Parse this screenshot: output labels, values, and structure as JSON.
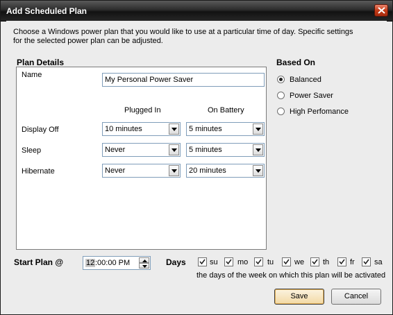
{
  "window": {
    "title": "Add Scheduled Plan"
  },
  "intro_line1": "Choose a Windows power plan that you would like to use at a particular time of day.  Specific settings",
  "intro_line2": "for the selected power plan can be adjusted.",
  "plan_details": {
    "title": "Plan Details",
    "name_label": "Name",
    "name_value": "My Personal Power Saver",
    "col_plugged": "Plugged In",
    "col_battery": "On Battery",
    "rows": [
      {
        "label": "Display Off",
        "plugged": "10 minutes",
        "battery": "5 minutes"
      },
      {
        "label": "Sleep",
        "plugged": "Never",
        "battery": "5 minutes"
      },
      {
        "label": "Hibernate",
        "plugged": "Never",
        "battery": "20 minutes"
      }
    ]
  },
  "based_on": {
    "title": "Based On",
    "options": [
      "Balanced",
      "Power Saver",
      "High Perfomance"
    ],
    "selected": "Balanced"
  },
  "start": {
    "label": "Start Plan @",
    "time_hour": "12",
    "time_rest": ":00:00 PM"
  },
  "days": {
    "label": "Days",
    "items": [
      {
        "label": "su",
        "checked": true
      },
      {
        "label": "mo",
        "checked": true
      },
      {
        "label": "tu",
        "checked": true
      },
      {
        "label": "we",
        "checked": true
      },
      {
        "label": "th",
        "checked": true
      },
      {
        "label": "fr",
        "checked": true
      },
      {
        "label": "sa",
        "checked": true
      }
    ],
    "hint": "the days of the week on which this plan will be activated"
  },
  "buttons": {
    "save": "Save",
    "cancel": "Cancel"
  }
}
